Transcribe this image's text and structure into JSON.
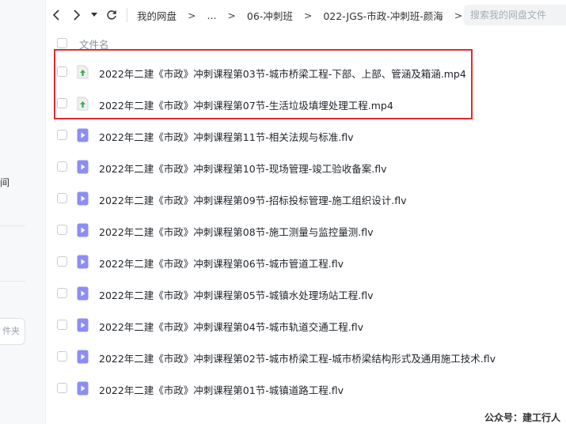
{
  "sidebar": {
    "partial_text": "间",
    "partial_button": "件夹"
  },
  "nav": {
    "back_icon": "chevron-left-icon",
    "forward_icon": "chevron-right-icon",
    "dropdown_icon": "caret-down-icon",
    "refresh_icon": "refresh-icon",
    "breadcrumbs": [
      "我的网盘",
      "...",
      "06-冲刺班",
      "022-JGS-市政-冲刺班-颜海"
    ],
    "separator": ">"
  },
  "search": {
    "placeholder": "搜索我的网盘文件"
  },
  "list": {
    "column_name": "文件名",
    "files": [
      {
        "name": "2022年二建《市政》冲刺课程第03节-城市桥梁工程-下部、上部、管涵及箱涵.mp4",
        "type": "mp4",
        "icon": "upload-file-icon"
      },
      {
        "name": "2022年二建《市政》冲刺课程第07节-生活垃圾填埋处理工程.mp4",
        "type": "mp4",
        "icon": "upload-file-icon"
      },
      {
        "name": "2022年二建《市政》冲刺课程第11节-相关法规与标准.flv",
        "type": "flv",
        "icon": "video-file-icon"
      },
      {
        "name": "2022年二建《市政》冲刺课程第10节-现场管理-竣工验收备案.flv",
        "type": "flv",
        "icon": "video-file-icon"
      },
      {
        "name": "2022年二建《市政》冲刺课程第09节-招标投标管理-施工组织设计.flv",
        "type": "flv",
        "icon": "video-file-icon"
      },
      {
        "name": "2022年二建《市政》冲刺课程第08节-施工测量与监控量测.flv",
        "type": "flv",
        "icon": "video-file-icon"
      },
      {
        "name": "2022年二建《市政》冲刺课程第06节-城市管道工程.flv",
        "type": "flv",
        "icon": "video-file-icon"
      },
      {
        "name": "2022年二建《市政》冲刺课程第05节-城镇水处理场站工程.flv",
        "type": "flv",
        "icon": "video-file-icon"
      },
      {
        "name": "2022年二建《市政》冲刺课程第04节-城市轨道交通工程.flv",
        "type": "flv",
        "icon": "video-file-icon"
      },
      {
        "name": "2022年二建《市政》冲刺课程第02节-城市桥梁工程-城市桥梁结构形式及通用施工技术.flv",
        "type": "flv",
        "icon": "video-file-icon"
      },
      {
        "name": "2022年二建《市政》冲刺课程第01节-城镇道路工程.flv",
        "type": "flv",
        "icon": "video-file-icon"
      }
    ]
  },
  "watermark": "公众号：建工行人",
  "colors": {
    "video_icon": "#8b8ef5",
    "upload_arrow": "#3fae4a",
    "highlight": "#e12b2b"
  }
}
